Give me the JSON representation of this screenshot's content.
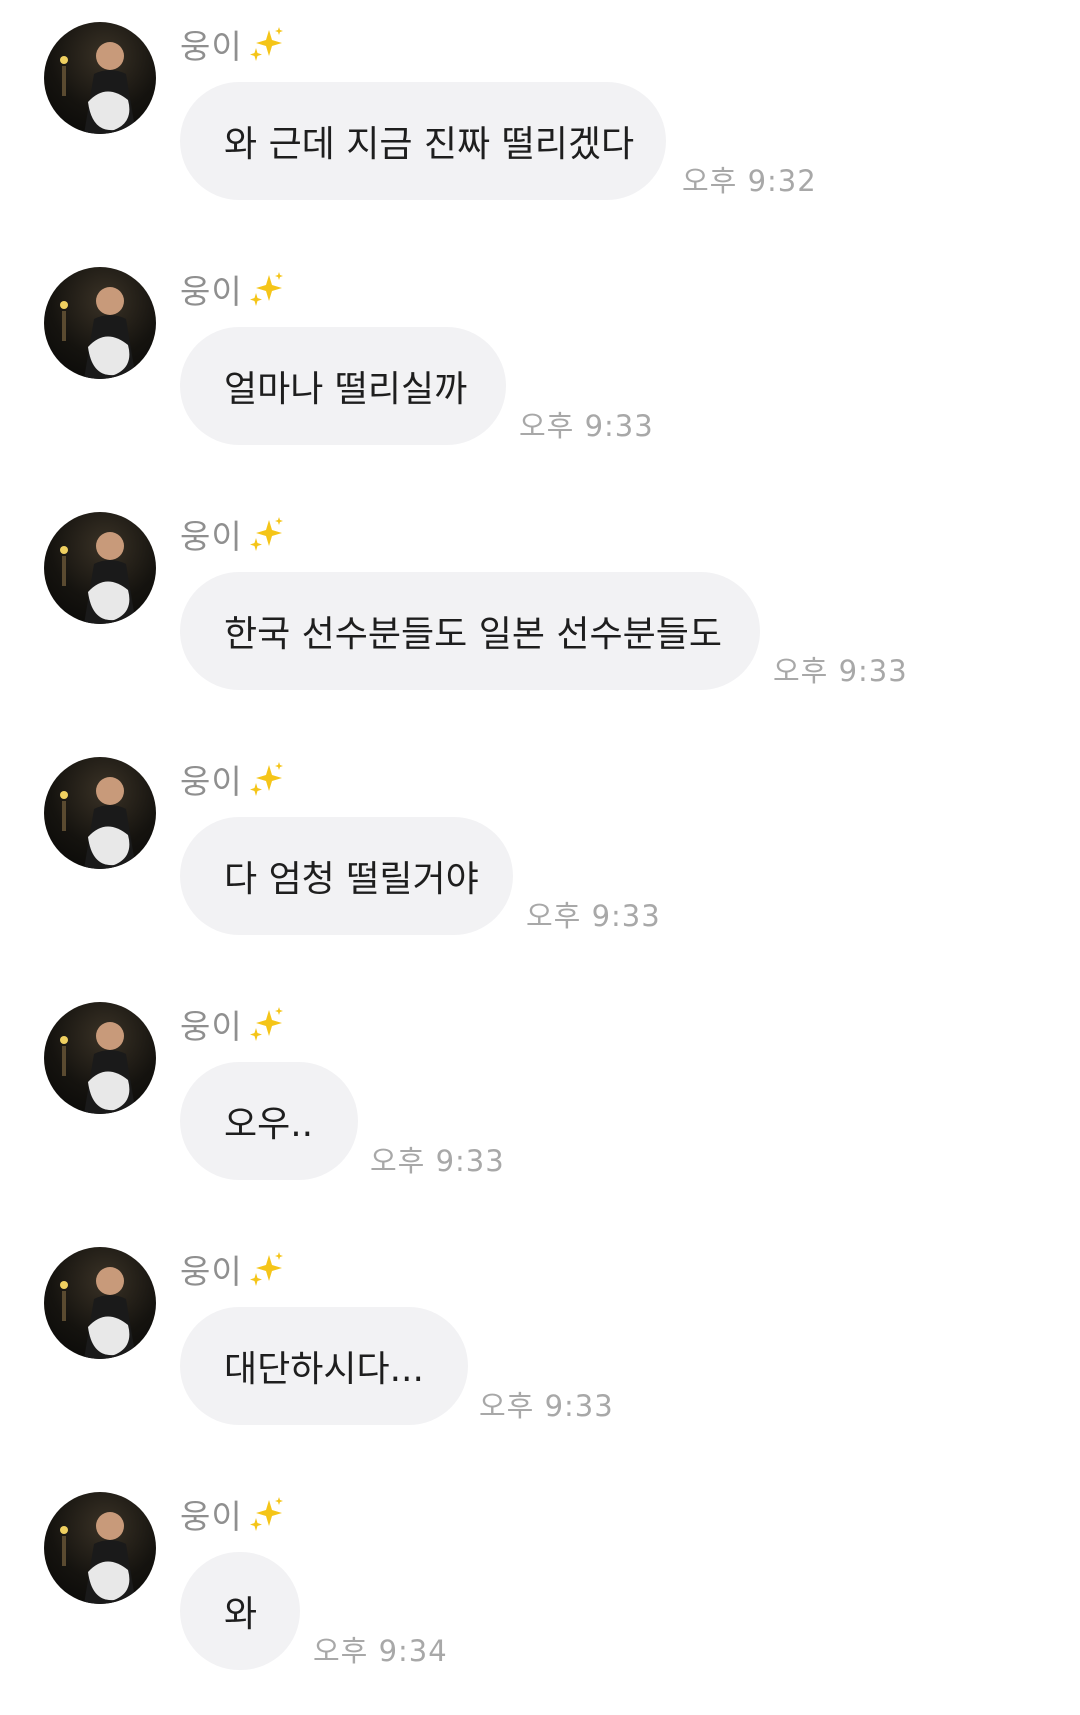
{
  "sender_name": "웅이",
  "sender_icon": "sparkles-emoji",
  "messages": [
    {
      "text": "와 근데 지금 진짜 떨리겠다",
      "time": "오후 9:32"
    },
    {
      "text": "얼마나 떨리실까",
      "time": "오후 9:33"
    },
    {
      "text": "한국 선수분들도 일본 선수분들도",
      "time": "오후 9:33"
    },
    {
      "text": "다 엄청 떨릴거야",
      "time": "오후 9:33"
    },
    {
      "text": "오우..",
      "time": "오후 9:33"
    },
    {
      "text": "대단하시다...",
      "time": "오후 9:33"
    },
    {
      "text": "와",
      "time": "오후 9:34"
    }
  ],
  "colors": {
    "bubble": "#f2f2f4",
    "text": "#1e1e1e",
    "sender": "#8f8f8f",
    "time": "#a8a8a8",
    "sparkle": "#f5c518"
  }
}
